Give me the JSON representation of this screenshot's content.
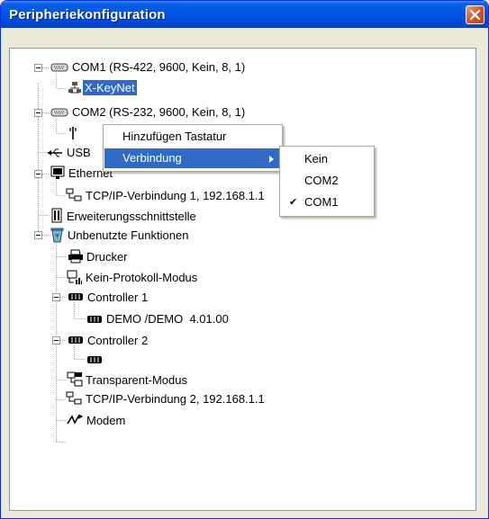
{
  "window": {
    "title": "Peripheriekonfiguration"
  },
  "tree": {
    "com1": "COM1 (RS-422, 9600, Kein, 8, 1)",
    "xkeynet": "X-KeyNet",
    "com2": "COM2 (RS-232, 9600, Kein, 8, 1)",
    "usb": "USB",
    "ethernet": "Ethernet",
    "tcp1": "TCP/IP-Verbindung 1, 192.168.1.1",
    "expansion": "Erweiterungsschnittstelle",
    "unused": "Unbenutzte Funktionen",
    "printer": "Drucker",
    "noprotocol": "Kein-Protokoll-Modus",
    "controller1": "Controller 1",
    "demo": "DEMO /DEMO  4.01.00",
    "controller2": "Controller 2",
    "transparent": "Transparent-Modus",
    "tcp2": "TCP/IP-Verbindung 2, 192.168.1.1",
    "modem": "Modem"
  },
  "context_menu": {
    "add_keyboard": "Hinzufügen Tastatur",
    "connection": "Verbindung"
  },
  "submenu": {
    "none": "Kein",
    "com2": "COM2",
    "com1": "COM1",
    "checkmark": "✔"
  },
  "colors": {
    "selection": "#316AC5",
    "titlebar": "#0055E5",
    "close": "#D9542A"
  }
}
